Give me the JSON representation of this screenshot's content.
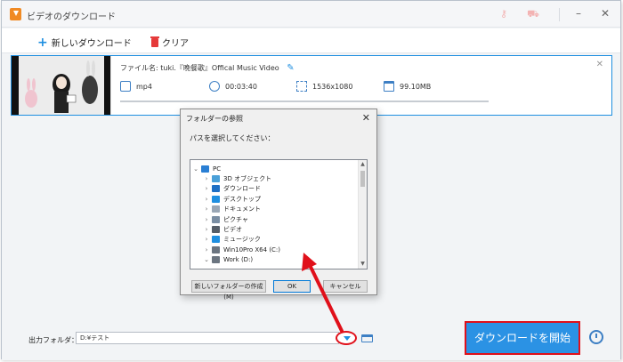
{
  "window": {
    "title": "ビデオのダウンロード"
  },
  "toolbar": {
    "new_download_label": "新しいダウンロード",
    "clear_label": "クリア"
  },
  "item": {
    "filename_prefix": "ファイル名:",
    "filename": "tuki.『晩餐歌』Offical Music Video",
    "format": "mp4",
    "duration": "00:03:40",
    "resolution": "1536x1080",
    "size": "99.10MB"
  },
  "dialog": {
    "title": "フォルダーの参照",
    "prompt": "パスを選択してください：",
    "tree": [
      {
        "label": "PC",
        "expanded": true,
        "icon": "pc-icon",
        "color": "#2a7fd4"
      },
      {
        "label": "3D オブジェクト",
        "icon": "3d-objects-icon",
        "color": "#4aa0d8"
      },
      {
        "label": "ダウンロード",
        "icon": "download-folder-icon",
        "color": "#1e6fc4"
      },
      {
        "label": "デスクトップ",
        "icon": "desktop-icon",
        "color": "#1f8fe0"
      },
      {
        "label": "ドキュメント",
        "icon": "documents-icon",
        "color": "#9aa7b5"
      },
      {
        "label": "ピクチャ",
        "icon": "pictures-icon",
        "color": "#7a8ea3"
      },
      {
        "label": "ビデオ",
        "icon": "videos-icon",
        "color": "#555e68"
      },
      {
        "label": "ミュージック",
        "icon": "music-icon",
        "color": "#1f8fe0"
      },
      {
        "label": "Win10Pro X64 (C:)",
        "icon": "drive-c-icon",
        "color": "#6b7580"
      },
      {
        "label": "Work (D:)",
        "expanded": true,
        "icon": "drive-d-icon",
        "color": "#6b7580"
      }
    ],
    "new_folder_label": "新しいフォルダーの作成(M)",
    "ok_label": "OK",
    "cancel_label": "キャンセル"
  },
  "footer": {
    "output_label": "出力フォルダ：",
    "output_path": "D:¥テスト",
    "start_label": "ダウンロードを開始"
  },
  "colors": {
    "accent": "#1f8fe0",
    "highlight": "#e0101a"
  }
}
